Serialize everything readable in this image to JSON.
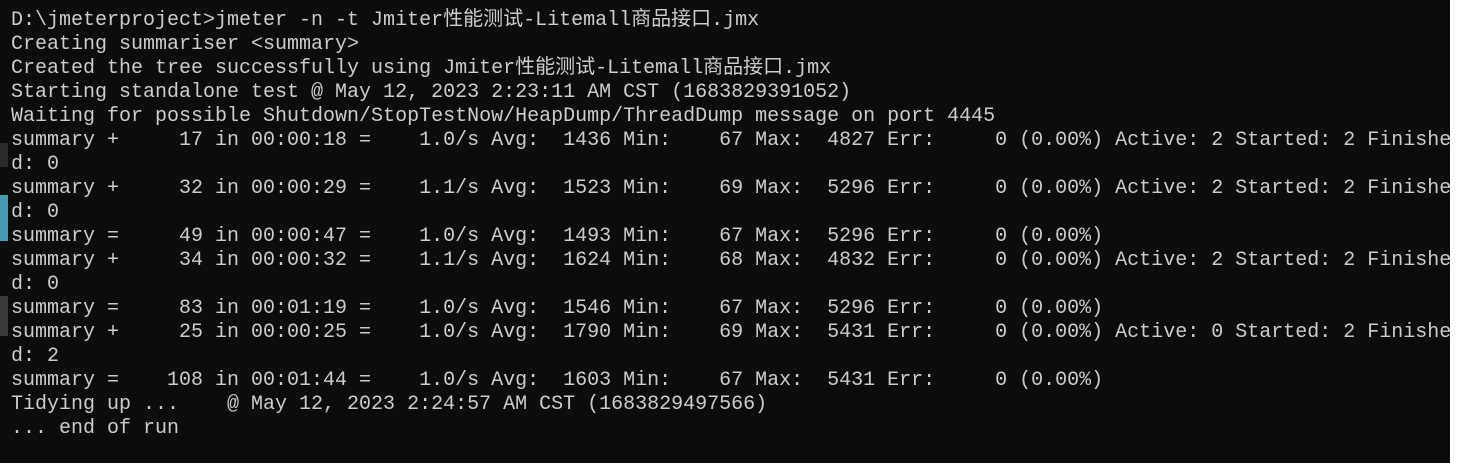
{
  "console": {
    "lines": [
      "D:\\jmeterproject>jmeter -n -t Jmiter性能测试-Litemall商品接口.jmx",
      "Creating summariser <summary>",
      "Created the tree successfully using Jmiter性能测试-Litemall商品接口.jmx",
      "Starting standalone test @ May 12, 2023 2:23:11 AM CST (1683829391052)",
      "Waiting for possible Shutdown/StopTestNow/HeapDump/ThreadDump message on port 4445",
      "summary +     17 in 00:00:18 =    1.0/s Avg:  1436 Min:    67 Max:  4827 Err:     0 (0.00%) Active: 2 Started: 2 Finishe",
      "d: 0",
      "summary +     32 in 00:00:29 =    1.1/s Avg:  1523 Min:    69 Max:  5296 Err:     0 (0.00%) Active: 2 Started: 2 Finishe",
      "d: 0",
      "summary =     49 in 00:00:47 =    1.0/s Avg:  1493 Min:    67 Max:  5296 Err:     0 (0.00%)",
      "summary +     34 in 00:00:32 =    1.1/s Avg:  1624 Min:    68 Max:  4832 Err:     0 (0.00%) Active: 2 Started: 2 Finishe",
      "d: 0",
      "summary =     83 in 00:01:19 =    1.0/s Avg:  1546 Min:    67 Max:  5296 Err:     0 (0.00%)",
      "summary +     25 in 00:00:25 =    1.0/s Avg:  1790 Min:    69 Max:  5431 Err:     0 (0.00%) Active: 0 Started: 2 Finishe",
      "d: 2",
      "summary =    108 in 00:01:44 =    1.0/s Avg:  1603 Min:    67 Max:  5431 Err:     0 (0.00%)",
      "Tidying up ...    @ May 12, 2023 2:24:57 AM CST (1683829497566)",
      "... end of run"
    ]
  },
  "colors": {
    "background": "#0c0c0c",
    "text": "#cccccc"
  }
}
